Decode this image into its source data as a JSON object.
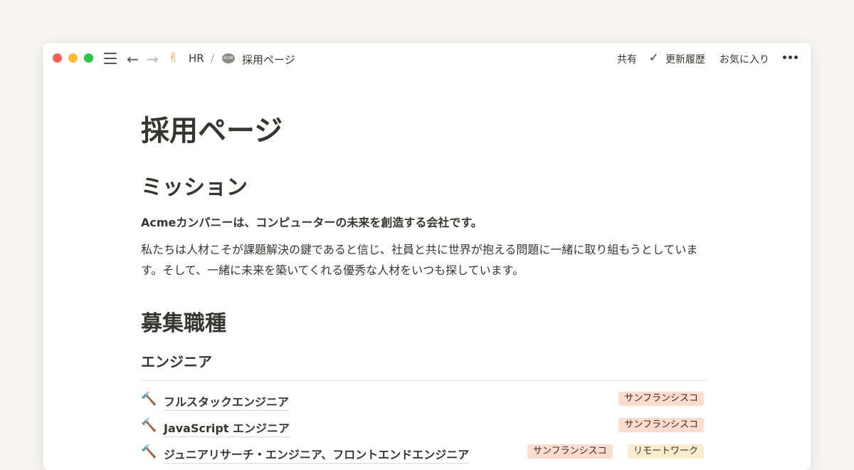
{
  "window": {
    "nav_back": "←",
    "nav_forward": "→",
    "breadcrumb": {
      "workspace_emoji": "✌",
      "workspace": "HR",
      "separator": "/",
      "page_logo": "ACME",
      "page": "採用ページ"
    },
    "toolbar": {
      "share": "共有",
      "check": "✓",
      "history": "更新履歴",
      "favorite": "お気に入り"
    }
  },
  "page": {
    "title": "採用ページ",
    "mission_heading": "ミッション",
    "mission_lead": "Acmeカンパニーは、コンピューターの未来を創造する会社です。",
    "mission_body": "私たちは人材こそが課題解決の鍵であると信じ、社員と共に世界が抱える問題に一緒に取り組もうとしています。そして、一緒に未来を築いてくれる優秀な人材をいつも探しています。",
    "jobs_heading": "募集職種",
    "engineering_heading": "エンジニア",
    "jobs": [
      {
        "icon": "🔨",
        "name": "フルスタックエンジニア",
        "tags": [
          "サンフランシスコ"
        ]
      },
      {
        "icon": "🔨",
        "name": "JavaScript エンジニア",
        "tags": [
          "サンフランシスコ"
        ]
      },
      {
        "icon": "🔨",
        "name": "ジュニアリサーチ・エンジニア、フロントエンドエンジニア",
        "tags": [
          "サンフランシスコ",
          "リモートワーク"
        ]
      }
    ]
  },
  "colors": {
    "background": "#f7f5f1",
    "text": "#37352f",
    "tag_orange": "#fbdccf",
    "tag_yellow": "#fbecd0"
  }
}
